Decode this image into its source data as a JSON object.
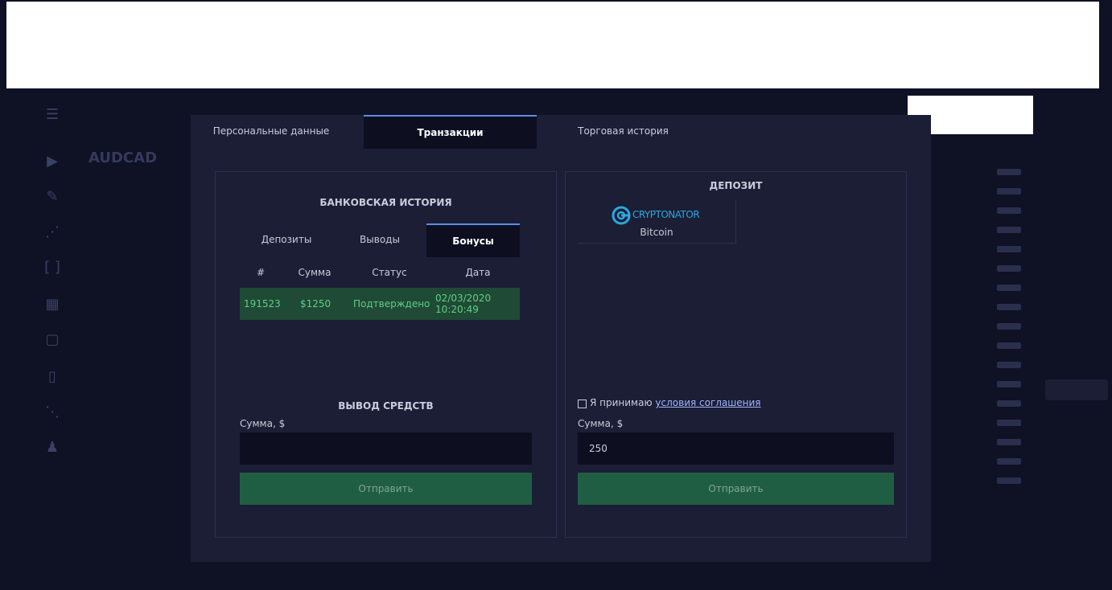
{
  "tabs": [
    "Персональные данные",
    "Транзакции",
    "Торговая история"
  ],
  "bank_history": {
    "title": "БАНКОВСКАЯ ИСТОРИЯ",
    "subtabs": [
      "Депозиты",
      "Выводы",
      "Бонусы"
    ],
    "columns": [
      "#",
      "Сумма",
      "Статус",
      "Дата"
    ],
    "rows": [
      {
        "id": "191523",
        "amount": "$1250",
        "status": "Подтверждено",
        "date": "02/03/2020",
        "time": "10:20:49"
      }
    ]
  },
  "withdraw": {
    "title": "ВЫВОД СРЕДСТВ",
    "amount_label": "Сумма,  $",
    "amount_value": "",
    "submit": "Отправить"
  },
  "deposit": {
    "title": "ДЕПОЗИТ",
    "provider_logo": "CRYPTONATOR",
    "provider_method": "Bitcoin",
    "agree_prefix": "Я принимаю",
    "agree_link": "условия соглашения",
    "amount_label": "Сумма,  $",
    "amount_value": "250",
    "submit": "Отправить"
  },
  "background": {
    "symbol": "AUDCAD"
  },
  "colors": {
    "accent": "#5b8de8",
    "success": "#5fcf86",
    "button": "#1f5e43",
    "panel": "#1b1e35"
  }
}
